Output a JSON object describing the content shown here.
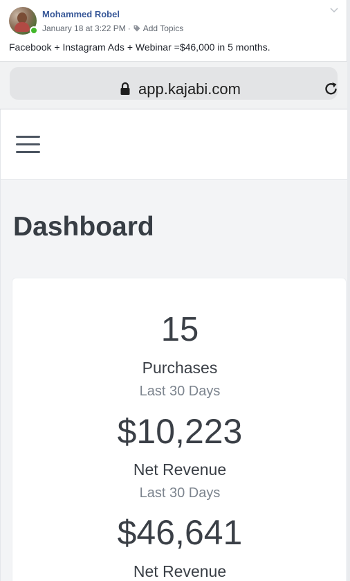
{
  "post": {
    "author": "Mohammed Robel",
    "timestamp": "January 18 at 3:22 PM",
    "separator": "·",
    "add_topics": "Add Topics",
    "text": "Facebook + Instagram Ads + Webinar =$46,000 in 5 months."
  },
  "browser": {
    "url": "app.kajabi.com",
    "icons": [
      "lock-icon",
      "reload-icon"
    ]
  },
  "app": {
    "menu_icon": "hamburger-menu-icon",
    "page_title": "Dashboard"
  },
  "stats": [
    {
      "value": "15",
      "label": "Purchases",
      "period": "Last 30 Days"
    },
    {
      "value": "$10,223",
      "label": "Net Revenue",
      "period": "Last 30 Days"
    },
    {
      "value": "$46,641",
      "label": "Net Revenue",
      "period": ""
    }
  ],
  "colors": {
    "author_link": "#385898",
    "online": "#42b72a",
    "title": "#373d44",
    "muted": "#7c848e"
  }
}
